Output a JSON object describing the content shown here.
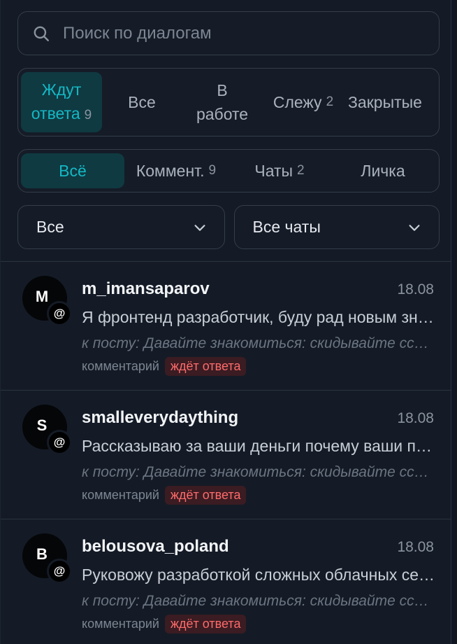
{
  "search": {
    "placeholder": "Поиск по диалогам"
  },
  "status_tabs": [
    {
      "label_line1": "Ждут",
      "label_line2": "ответа",
      "count": "9",
      "active": true
    },
    {
      "label": "Все"
    },
    {
      "label_line1": "В",
      "label_line2": "работе"
    },
    {
      "label": "Слежу",
      "count": "2"
    },
    {
      "label": "Закрытые"
    }
  ],
  "type_tabs": [
    {
      "label": "Всё",
      "active": true
    },
    {
      "label": "Коммент.",
      "count": "9"
    },
    {
      "label": "Чаты",
      "count": "2"
    },
    {
      "label": "Личка"
    }
  ],
  "filters": {
    "scope": "Все",
    "chats": "Все чаты"
  },
  "dialogs": [
    {
      "avatar_letter": "M",
      "badge_symbol": "@",
      "name": "m_imansaparov",
      "date": "18.08",
      "preview": "Я фронтенд разработчик, буду рад новым знакомствам",
      "post": "к посту: Давайте знакомиться: скидывайте ссылки",
      "kind": "комментарий",
      "status": "ждёт ответа"
    },
    {
      "avatar_letter": "S",
      "badge_symbol": "@",
      "name": "smalleverydaything",
      "date": "18.08",
      "preview": "Рассказываю за ваши деньги почему ваши продукты",
      "post": "к посту: Давайте знакомиться: скидывайте ссылки",
      "kind": "комментарий",
      "status": "ждёт ответа"
    },
    {
      "avatar_letter": "B",
      "badge_symbol": "@",
      "name": "belousova_poland",
      "date": "18.08",
      "preview": "Руковожу разработкой сложных облачных сервисов",
      "post": "к посту: Давайте знакомиться: скидывайте ссылки",
      "kind": "комментарий",
      "status": "ждёт ответа"
    }
  ],
  "colors": {
    "accent": "#14b8c4",
    "accent_bg": "#0f3a42",
    "awaiting": "#ff6b6b"
  }
}
